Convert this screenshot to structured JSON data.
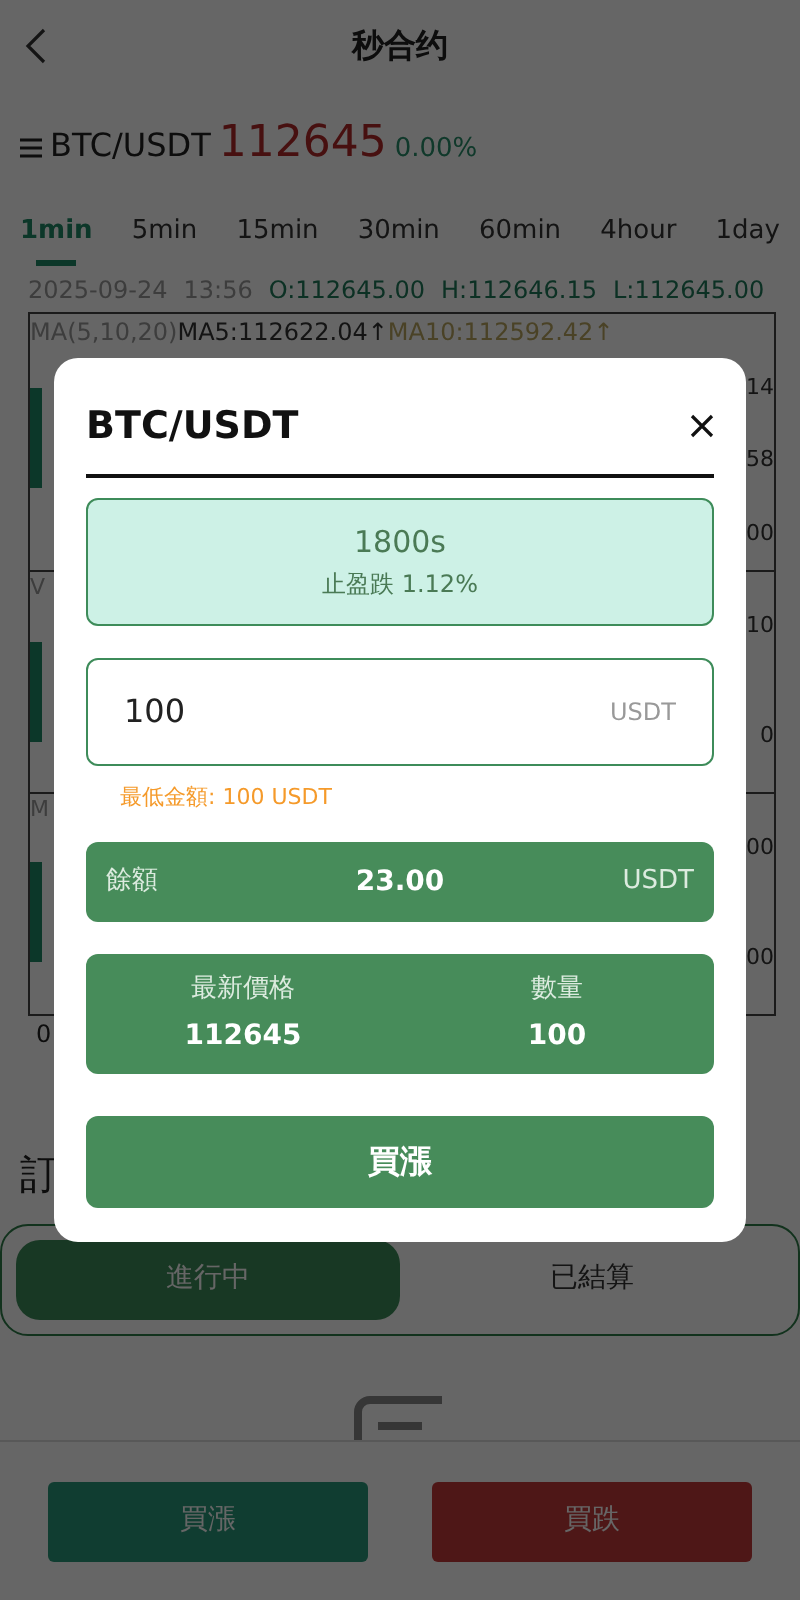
{
  "header": {
    "title": "秒合约"
  },
  "pair": {
    "symbol": "BTC/USDT",
    "price": "112645",
    "change": "0.00%"
  },
  "intervals": [
    {
      "label": "1min",
      "selected": true
    },
    {
      "label": "5min",
      "selected": false
    },
    {
      "label": "15min",
      "selected": false
    },
    {
      "label": "30min",
      "selected": false
    },
    {
      "label": "60min",
      "selected": false
    },
    {
      "label": "4hour",
      "selected": false
    },
    {
      "label": "1day",
      "selected": false
    }
  ],
  "ohlc": {
    "date": "2025-09-24",
    "time": "13:56",
    "open": "O:112645.00",
    "high": "H:112646.15",
    "low": "L:112645.00"
  },
  "chart": {
    "ma_label": "MA(5,10,20)",
    "ma5": "MA5:112622.04↑",
    "ma10": "MA10:112592.42↑",
    "sections": [
      {
        "right_labels": [
          "14",
          "58",
          "00"
        ]
      },
      {
        "left_label": "V",
        "right_labels": [
          "10",
          "0"
        ]
      },
      {
        "left_label": "M",
        "right_labels": [
          "00",
          "00"
        ]
      }
    ],
    "bottom_label": "0"
  },
  "orders": {
    "heading": "訂",
    "tabs": [
      {
        "label": "進行中",
        "selected": true
      },
      {
        "label": "已結算",
        "selected": false
      }
    ]
  },
  "bottom_buttons": [
    {
      "label": "買漲",
      "kind": "up"
    },
    {
      "label": "買跌",
      "kind": "down"
    }
  ],
  "modal": {
    "title": "BTC/USDT",
    "duration": {
      "value": "1800s",
      "profit": "止盈跌 1.12%",
      "selected": true
    },
    "amount": {
      "value": "100",
      "unit": "USDT"
    },
    "min_note": "最低金額: 100 USDT",
    "balance": {
      "label": "餘額",
      "value": "23.00",
      "unit": "USDT"
    },
    "price": {
      "label": "最新價格",
      "value": "112645"
    },
    "quantity": {
      "label": "數量",
      "value": "100"
    },
    "submit": "買漲"
  }
}
